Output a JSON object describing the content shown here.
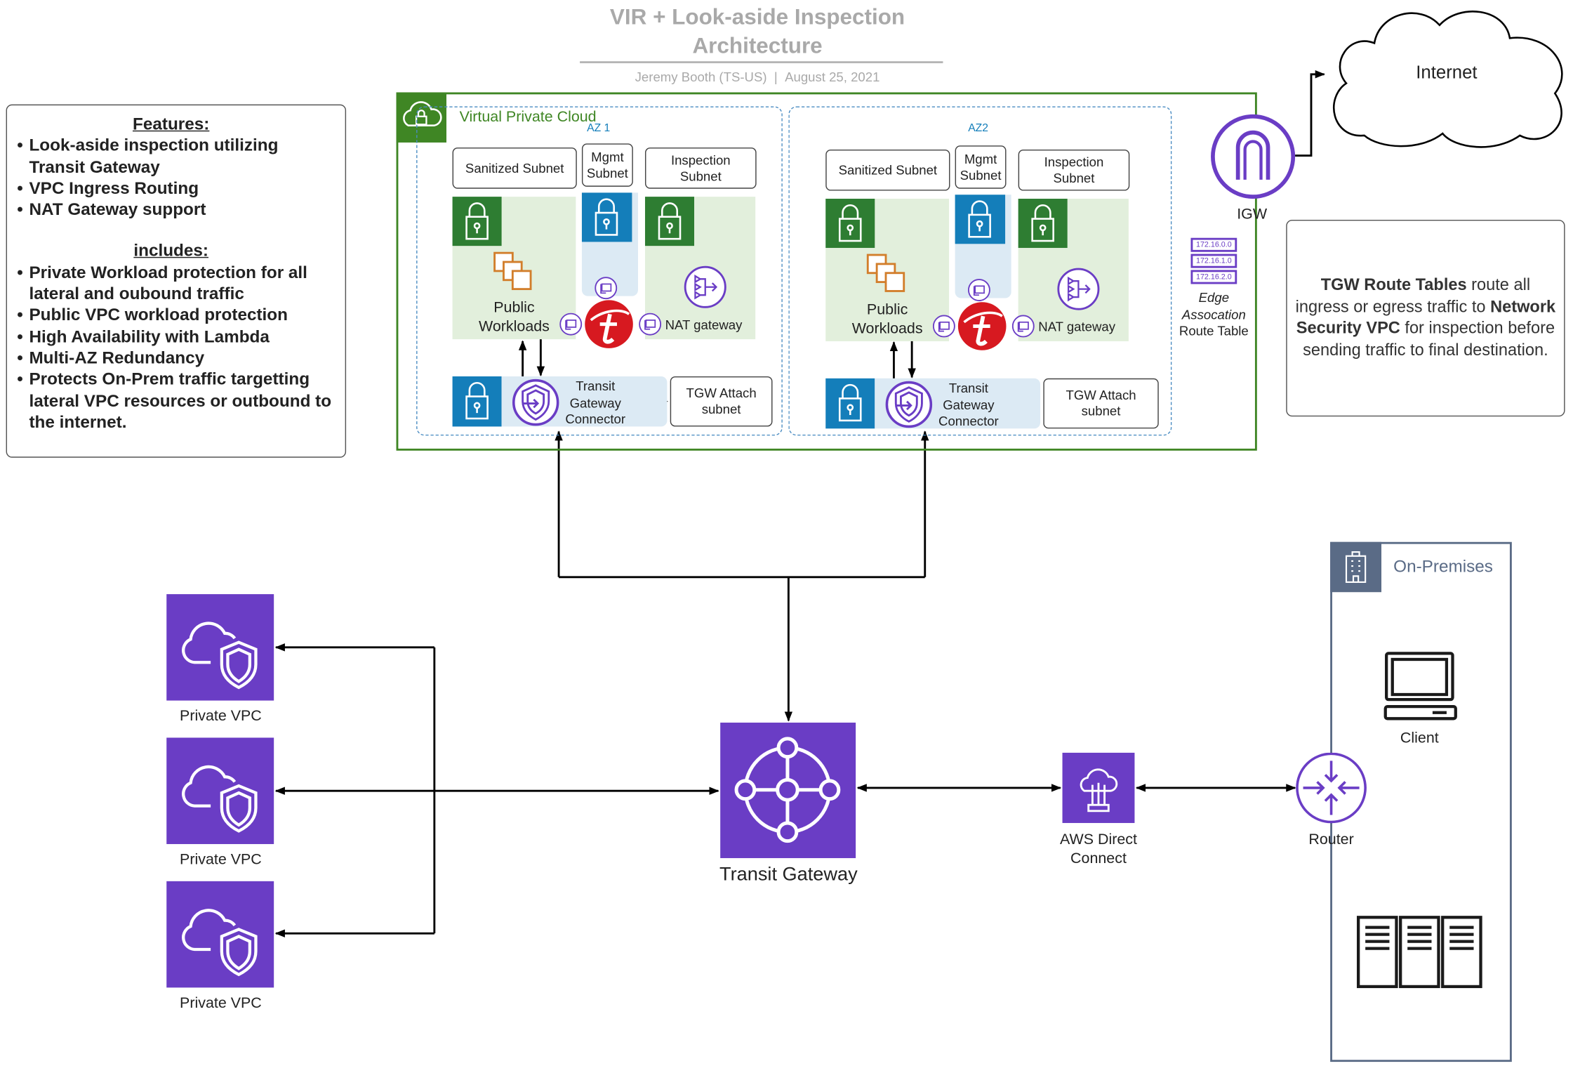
{
  "header": {
    "title_line1": "VIR + Look-aside Inspection",
    "title_line2": "Architecture",
    "author": "Jeremy Booth (TS-US)",
    "separator": "|",
    "date": "August 25, 2021"
  },
  "features": {
    "heading": "Features:",
    "items": [
      "Look-aside inspection utilizing Transit Gateway",
      "VPC Ingress Routing",
      "NAT Gateway support"
    ],
    "includes_heading": "includes:",
    "includes": [
      "Private Workload protection for all lateral and oubound traffic",
      "Public VPC workload protection",
      "High Availability with Lambda",
      "Multi-AZ Redundancy",
      "Protects On-Prem traffic targetting lateral VPC resources or outbound to the internet."
    ]
  },
  "vpc": {
    "label": "Virtual Private Cloud",
    "azs": [
      {
        "label": "AZ 1",
        "sanitized": "Sanitized Subnet",
        "mgmt": "Mgmt Subnet",
        "inspection": "Inspection Subnet",
        "workloads": "Public Workloads",
        "nat": "NAT gateway",
        "connector": "Transit Gateway Connector",
        "attach": "TGW Attach subnet"
      },
      {
        "label": "AZ2",
        "sanitized": "Sanitized Subnet",
        "mgmt": "Mgmt Subnet",
        "inspection": "Inspection Subnet",
        "workloads": "Public Workloads",
        "nat": "NAT gateway",
        "connector": "Transit Gateway Connector",
        "attach": "TGW Attach subnet"
      }
    ],
    "route_table": {
      "routes": [
        "172.16.0.0",
        "172.16.1.0",
        "172.16.2.0"
      ],
      "label_italic": "Edge Assocation",
      "label": "Route Table"
    }
  },
  "igw": {
    "label": "IGW"
  },
  "internet": {
    "label": "Internet"
  },
  "note": {
    "bold1": "TGW Route Tables",
    "text1": " route all ingress or egress traffic to ",
    "bold2": "Network Security VPC",
    "text2": " for inspection before sending traffic to final destination."
  },
  "private_vpcs": [
    {
      "label": "Private VPC"
    },
    {
      "label": "Private VPC"
    },
    {
      "label": "Private VPC"
    }
  ],
  "transit_gateway": {
    "label": "Transit Gateway"
  },
  "direct_connect": {
    "label": "AWS Direct Connect"
  },
  "on_premises": {
    "label": "On-Premises",
    "router": "Router",
    "client": "Client"
  },
  "colors": {
    "vpc_green": "#3f8624",
    "subnet_blue": "#147eba",
    "aws_purple": "#6a3dc5",
    "onprem_slate": "#5a6b86",
    "trend_red": "#d71920"
  }
}
